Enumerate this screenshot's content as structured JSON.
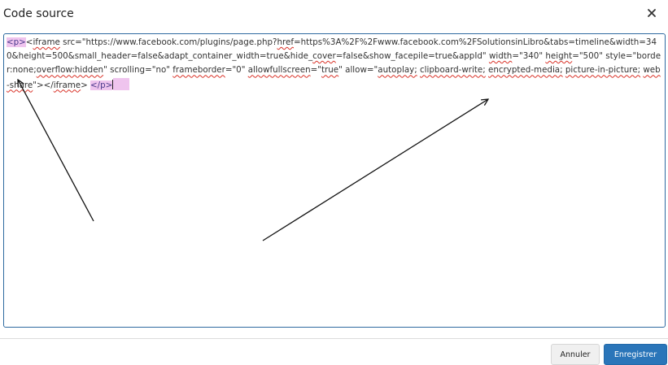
{
  "dialog": {
    "title": "Code source",
    "close_icon": "close-icon",
    "buttons": {
      "cancel_label": "Annuler",
      "save_label": "Enregistrer"
    }
  },
  "editor": {
    "open_tag": "<p>",
    "iframe_tag": "iframe",
    "src_text": " src=\"https://www.facebook.com/plugins/page.php?",
    "href_attr": "href",
    "href_value": "=https%3A%2F%2Fwww.facebook.com%2FSolutionsinLibro&tabs=timeline&width=340&height=500&small_header=false&adapt_container_width=true&hide_",
    "cover_word": "cover",
    "after_cover": "=false&show_facepile=true&appId\" ",
    "width_attr": "width",
    "width_value": "=\"340\" ",
    "height_attr": "height",
    "height_value": "=\"500\" style=\"border:none;",
    "overflow_text": "overflow:hidden",
    "scrolling_text": "\" scrolling=\"no\" ",
    "frameborder_attr": "frameborder",
    "frameborder_value": "=\"0\" ",
    "allowfullscreen_attr": "allowfullscreen",
    "eq_quote": "=\"",
    "true_word": "true",
    "quote_space": "\" ",
    "allow_attr": "allow",
    "allow_eq": "=\"",
    "autoplay_text": "autoplay;",
    "space": " ",
    "clipboard_text": "clipboard-write;",
    "encrypted_text": "encrypted-media;",
    "pip_text": "picture-in-picture;",
    "webshare_text": "web-share",
    "close_quote": "\"></",
    "closing_iframe": "iframe",
    "gt_space": "> ",
    "close_tag": "</p>"
  },
  "colors": {
    "accent": "#2a75b9",
    "highlight": "#efc4ee",
    "spellcheck": "#d93025"
  }
}
